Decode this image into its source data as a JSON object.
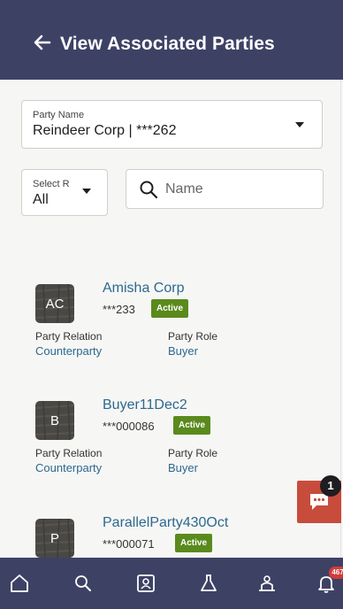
{
  "header": {
    "title": "View Associated Parties",
    "back_icon": "arrow-left-icon"
  },
  "filters": {
    "party_name": {
      "label": "Party Name",
      "value": "Reindeer Corp | ***262"
    },
    "relation": {
      "label": "Select R",
      "value": "All"
    },
    "search": {
      "placeholder": "Name",
      "value": ""
    }
  },
  "parties": [
    {
      "initials": "AC",
      "name": "Amisha Corp",
      "masked_id": "***233",
      "status": "Active",
      "relation_label": "Party Relation",
      "relation": "Counterparty",
      "role_label": "Party Role",
      "role": "Buyer"
    },
    {
      "initials": "B",
      "name": "Buyer11Dec2",
      "masked_id": "***000086",
      "status": "Active",
      "relation_label": "Party Relation",
      "relation": "Counterparty",
      "role_label": "Party Role",
      "role": "Buyer"
    },
    {
      "initials": "P",
      "name": "ParallelParty430Oct",
      "masked_id": "***000071",
      "status": "Active"
    }
  ],
  "chat": {
    "count": "1",
    "icon": "chat-bubble-icon"
  },
  "tabbar": {
    "items": [
      "home-icon",
      "search-icon",
      "dashboard-icon",
      "flask-icon",
      "accounts-icon",
      "bell-icon"
    ],
    "notification_count": "467"
  },
  "colors": {
    "header_bg": "#3d4265",
    "link": "#2c6990",
    "badge_active": "#5a8a1d",
    "chat_button": "#c84c3c",
    "notification": "#d23b3b"
  }
}
